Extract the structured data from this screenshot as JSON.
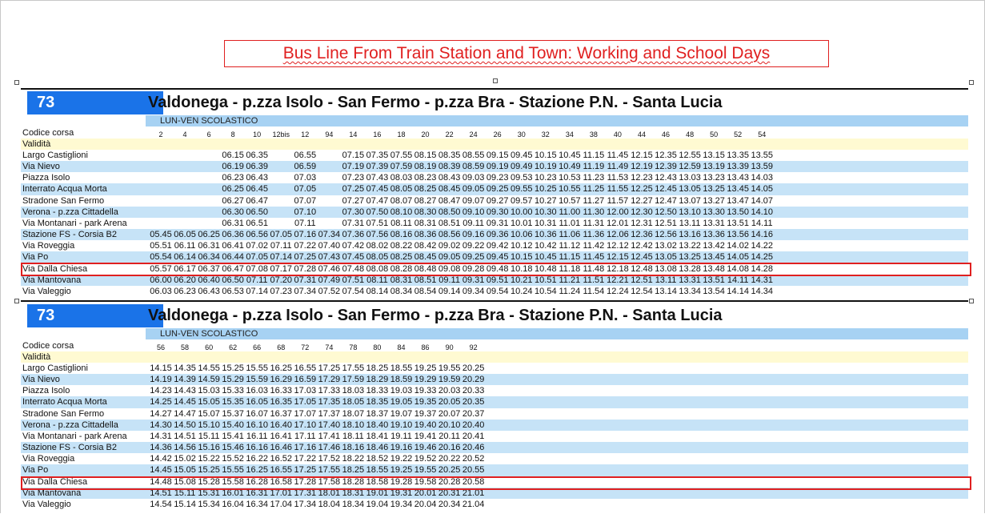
{
  "document": {
    "heading": "Bus Line From Train Station and Town: Working and School Days"
  },
  "timetables": [
    {
      "line": "73",
      "route": "Valdonega - p.zza Isolo - San Fermo - p.zza Bra - Stazione P.N. - Santa Lucia",
      "day_type": "LUN-VEN SCOLASTICO",
      "code_label": "Codice corsa",
      "validity_label": "Validità",
      "codes": [
        "2",
        "4",
        "6",
        "8",
        "10",
        "12bis",
        "12",
        "94",
        "14",
        "16",
        "18",
        "20",
        "22",
        "24",
        "26",
        "30",
        "32",
        "34",
        "38",
        "40",
        "44",
        "46",
        "48",
        "50",
        "52",
        "54"
      ],
      "stops": [
        {
          "name": "Largo Castiglioni",
          "times": [
            "",
            "",
            "",
            "06.15",
            "06.35",
            "",
            "06.55",
            "",
            "07.15",
            "07.35",
            "07.55",
            "08.15",
            "08.35",
            "08.55",
            "09.15",
            "09.45",
            "10.15",
            "10.45",
            "11.15",
            "11.45",
            "12.15",
            "12.35",
            "12.55",
            "13.15",
            "13.35",
            "13.55"
          ]
        },
        {
          "name": "Via Nievo",
          "times": [
            "",
            "",
            "",
            "06.19",
            "06.39",
            "",
            "06.59",
            "",
            "07.19",
            "07.39",
            "07.59",
            "08.19",
            "08.39",
            "08.59",
            "09.19",
            "09.49",
            "10.19",
            "10.49",
            "11.19",
            "11.49",
            "12.19",
            "12.39",
            "12.59",
            "13.19",
            "13.39",
            "13.59"
          ]
        },
        {
          "name": "Piazza Isolo",
          "times": [
            "",
            "",
            "",
            "06.23",
            "06.43",
            "",
            "07.03",
            "",
            "07.23",
            "07.43",
            "08.03",
            "08.23",
            "08.43",
            "09.03",
            "09.23",
            "09.53",
            "10.23",
            "10.53",
            "11.23",
            "11.53",
            "12.23",
            "12.43",
            "13.03",
            "13.23",
            "13.43",
            "14.03"
          ]
        },
        {
          "name": "Interrato Acqua Morta",
          "times": [
            "",
            "",
            "",
            "06.25",
            "06.45",
            "",
            "07.05",
            "",
            "07.25",
            "07.45",
            "08.05",
            "08.25",
            "08.45",
            "09.05",
            "09.25",
            "09.55",
            "10.25",
            "10.55",
            "11.25",
            "11.55",
            "12.25",
            "12.45",
            "13.05",
            "13.25",
            "13.45",
            "14.05"
          ]
        },
        {
          "name": "Stradone San Fermo",
          "times": [
            "",
            "",
            "",
            "06.27",
            "06.47",
            "",
            "07.07",
            "",
            "07.27",
            "07.47",
            "08.07",
            "08.27",
            "08.47",
            "09.07",
            "09.27",
            "09.57",
            "10.27",
            "10.57",
            "11.27",
            "11.57",
            "12.27",
            "12.47",
            "13.07",
            "13.27",
            "13.47",
            "14.07"
          ]
        },
        {
          "name": "Verona - p.zza Cittadella",
          "times": [
            "",
            "",
            "",
            "06.30",
            "06.50",
            "",
            "07.10",
            "",
            "07.30",
            "07.50",
            "08.10",
            "08.30",
            "08.50",
            "09.10",
            "09.30",
            "10.00",
            "10.30",
            "11.00",
            "11.30",
            "12.00",
            "12.30",
            "12.50",
            "13.10",
            "13.30",
            "13.50",
            "14.10"
          ]
        },
        {
          "name": "Via Montanari - park Arena",
          "times": [
            "",
            "",
            "",
            "06.31",
            "06.51",
            "",
            "07.11",
            "",
            "07.31",
            "07.51",
            "08.11",
            "08.31",
            "08.51",
            "09.11",
            "09.31",
            "10.01",
            "10.31",
            "11.01",
            "11.31",
            "12.01",
            "12.31",
            "12.51",
            "13.11",
            "13.31",
            "13.51",
            "14.11"
          ]
        },
        {
          "name": "Stazione FS - Corsia B2",
          "times": [
            "05.45",
            "06.05",
            "06.25",
            "06.36",
            "06.56",
            "07.05",
            "07.16",
            "07.34",
            "07.36",
            "07.56",
            "08.16",
            "08.36",
            "08.56",
            "09.16",
            "09.36",
            "10.06",
            "10.36",
            "11.06",
            "11.36",
            "12.06",
            "12.36",
            "12.56",
            "13.16",
            "13.36",
            "13.56",
            "14.16"
          ]
        },
        {
          "name": "Via Roveggia",
          "times": [
            "05.51",
            "06.11",
            "06.31",
            "06.41",
            "07.02",
            "07.11",
            "07.22",
            "07.40",
            "07.42",
            "08.02",
            "08.22",
            "08.42",
            "09.02",
            "09.22",
            "09.42",
            "10.12",
            "10.42",
            "11.12",
            "11.42",
            "12.12",
            "12.42",
            "13.02",
            "13.22",
            "13.42",
            "14.02",
            "14.22"
          ]
        },
        {
          "name": "Via Po",
          "times": [
            "05.54",
            "06.14",
            "06.34",
            "06.44",
            "07.05",
            "07.14",
            "07.25",
            "07.43",
            "07.45",
            "08.05",
            "08.25",
            "08.45",
            "09.05",
            "09.25",
            "09.45",
            "10.15",
            "10.45",
            "11.15",
            "11.45",
            "12.15",
            "12.45",
            "13.05",
            "13.25",
            "13.45",
            "14.05",
            "14.25"
          ]
        },
        {
          "name": "Via Dalla Chiesa",
          "times": [
            "05.57",
            "06.17",
            "06.37",
            "06.47",
            "07.08",
            "07.17",
            "07.28",
            "07.46",
            "07.48",
            "08.08",
            "08.28",
            "08.48",
            "09.08",
            "09.28",
            "09.48",
            "10.18",
            "10.48",
            "11.18",
            "11.48",
            "12.18",
            "12.48",
            "13.08",
            "13.28",
            "13.48",
            "14.08",
            "14.28"
          ]
        },
        {
          "name": "Via Mantovana",
          "times": [
            "06.00",
            "06.20",
            "06.40",
            "06.50",
            "07.11",
            "07.20",
            "07.31",
            "07.49",
            "07.51",
            "08.11",
            "08.31",
            "08.51",
            "09.11",
            "09.31",
            "09.51",
            "10.21",
            "10.51",
            "11.21",
            "11.51",
            "12.21",
            "12.51",
            "13.11",
            "13.31",
            "13.51",
            "14.11",
            "14.31"
          ]
        },
        {
          "name": "Via Valeggio",
          "times": [
            "06.03",
            "06.23",
            "06.43",
            "06.53",
            "07.14",
            "07.23",
            "07.34",
            "07.52",
            "07.54",
            "08.14",
            "08.34",
            "08.54",
            "09.14",
            "09.34",
            "09.54",
            "10.24",
            "10.54",
            "11.24",
            "11.54",
            "12.24",
            "12.54",
            "13.14",
            "13.34",
            "13.54",
            "14.14",
            "14.34"
          ]
        }
      ]
    },
    {
      "line": "73",
      "route": "Valdonega - p.zza Isolo - San Fermo - p.zza Bra - Stazione P.N. - Santa Lucia",
      "day_type": "LUN-VEN SCOLASTICO",
      "code_label": "Codice corsa",
      "validity_label": "Validità",
      "codes": [
        "56",
        "58",
        "60",
        "62",
        "66",
        "68",
        "72",
        "74",
        "78",
        "80",
        "84",
        "86",
        "90",
        "92"
      ],
      "stops": [
        {
          "name": "Largo Castiglioni",
          "times": [
            "14.15",
            "14.35",
            "14.55",
            "15.25",
            "15.55",
            "16.25",
            "16.55",
            "17.25",
            "17.55",
            "18.25",
            "18.55",
            "19.25",
            "19.55",
            "20.25"
          ]
        },
        {
          "name": "Via Nievo",
          "times": [
            "14.19",
            "14.39",
            "14.59",
            "15.29",
            "15.59",
            "16.29",
            "16.59",
            "17.29",
            "17.59",
            "18.29",
            "18.59",
            "19.29",
            "19.59",
            "20.29"
          ]
        },
        {
          "name": "Piazza Isolo",
          "times": [
            "14.23",
            "14.43",
            "15.03",
            "15.33",
            "16.03",
            "16.33",
            "17.03",
            "17.33",
            "18.03",
            "18.33",
            "19.03",
            "19.33",
            "20.03",
            "20.33"
          ]
        },
        {
          "name": "Interrato Acqua Morta",
          "times": [
            "14.25",
            "14.45",
            "15.05",
            "15.35",
            "16.05",
            "16.35",
            "17.05",
            "17.35",
            "18.05",
            "18.35",
            "19.05",
            "19.35",
            "20.05",
            "20.35"
          ]
        },
        {
          "name": "Stradone San Fermo",
          "times": [
            "14.27",
            "14.47",
            "15.07",
            "15.37",
            "16.07",
            "16.37",
            "17.07",
            "17.37",
            "18.07",
            "18.37",
            "19.07",
            "19.37",
            "20.07",
            "20.37"
          ]
        },
        {
          "name": "Verona - p.zza Cittadella",
          "times": [
            "14.30",
            "14.50",
            "15.10",
            "15.40",
            "16.10",
            "16.40",
            "17.10",
            "17.40",
            "18.10",
            "18.40",
            "19.10",
            "19.40",
            "20.10",
            "20.40"
          ]
        },
        {
          "name": "Via Montanari - park Arena",
          "times": [
            "14.31",
            "14.51",
            "15.11",
            "15.41",
            "16.11",
            "16.41",
            "17.11",
            "17.41",
            "18.11",
            "18.41",
            "19.11",
            "19.41",
            "20.11",
            "20.41"
          ]
        },
        {
          "name": "Stazione FS - Corsia B2",
          "times": [
            "14.36",
            "14.56",
            "15.16",
            "15.46",
            "16.16",
            "16.46",
            "17.16",
            "17.46",
            "18.16",
            "18.46",
            "19.16",
            "19.46",
            "20.16",
            "20.46"
          ]
        },
        {
          "name": "Via Roveggia",
          "times": [
            "14.42",
            "15.02",
            "15.22",
            "15.52",
            "16.22",
            "16.52",
            "17.22",
            "17.52",
            "18.22",
            "18.52",
            "19.22",
            "19.52",
            "20.22",
            "20.52"
          ]
        },
        {
          "name": "Via Po",
          "times": [
            "14.45",
            "15.05",
            "15.25",
            "15.55",
            "16.25",
            "16.55",
            "17.25",
            "17.55",
            "18.25",
            "18.55",
            "19.25",
            "19.55",
            "20.25",
            "20.55"
          ]
        },
        {
          "name": "Via Dalla Chiesa",
          "times": [
            "14.48",
            "15.08",
            "15.28",
            "15.58",
            "16.28",
            "16.58",
            "17.28",
            "17.58",
            "18.28",
            "18.58",
            "19.28",
            "19.58",
            "20.28",
            "20.58"
          ]
        },
        {
          "name": "Via Mantovana",
          "times": [
            "14.51",
            "15.11",
            "15.31",
            "16.01",
            "16.31",
            "17.01",
            "17.31",
            "18.01",
            "18.31",
            "19.01",
            "19.31",
            "20.01",
            "20.31",
            "21.01"
          ]
        },
        {
          "name": "Via Valeggio",
          "times": [
            "14.54",
            "15.14",
            "15.34",
            "16.04",
            "16.34",
            "17.04",
            "17.34",
            "18.04",
            "18.34",
            "19.04",
            "19.34",
            "20.04",
            "20.34",
            "21.04"
          ]
        }
      ]
    }
  ],
  "colors": {
    "line_badge": "#1a73e8",
    "day_type_band": "#a7d2f3",
    "alt_row": "#c6e3f7",
    "validity_row": "#fffad2",
    "highlight": "#e02020"
  }
}
